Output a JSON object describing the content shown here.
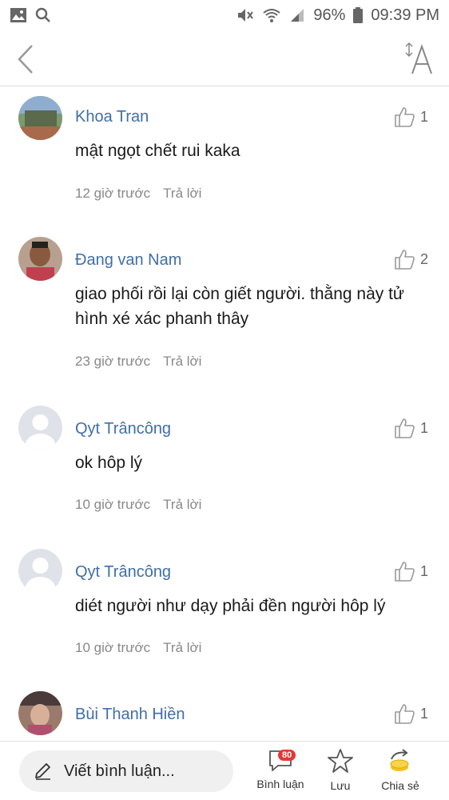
{
  "status_bar": {
    "battery": "96%",
    "time": "09:39 PM"
  },
  "comments": [
    {
      "user": "Khoa Tran",
      "likes": "1",
      "content": "mật ngọt chết rui kaka",
      "time": "12 giờ trước",
      "reply": "Trả lời",
      "avatar_color": "#6a8c5a"
    },
    {
      "user": "Đang van Nam",
      "likes": "2",
      "content": "giao phối rồi lại còn giết người. thằng này tử hình xé xác phanh thây",
      "time": "23 giờ trước",
      "reply": "Trả lời",
      "avatar_color": "#8a5a4a"
    },
    {
      "user": "Qyt Trâncông",
      "likes": "1",
      "content": "ok hôp lý",
      "time": "10 giờ trước",
      "reply": "Trả lời",
      "avatar_color": "#d8dce3"
    },
    {
      "user": "Qyt Trâncông",
      "likes": "1",
      "content": "diét người như dạy  phải đền người  hôp lý",
      "time": "10 giờ trước",
      "reply": "Trả lời",
      "avatar_color": "#d8dce3"
    },
    {
      "user": "Bùi Thanh Hiền",
      "likes": "1",
      "content": "",
      "time": "",
      "reply": "",
      "avatar_color": "#7a5a5a"
    }
  ],
  "bottom_bar": {
    "write_placeholder": "Viết bình luận...",
    "comments_label": "Bình luận",
    "comments_count": "80",
    "save_label": "Lưu",
    "share_label": "Chia sẻ"
  },
  "colors": {
    "username": "#3f6fa8",
    "badge": "#e53935",
    "share_coin": "#f4c21b"
  }
}
